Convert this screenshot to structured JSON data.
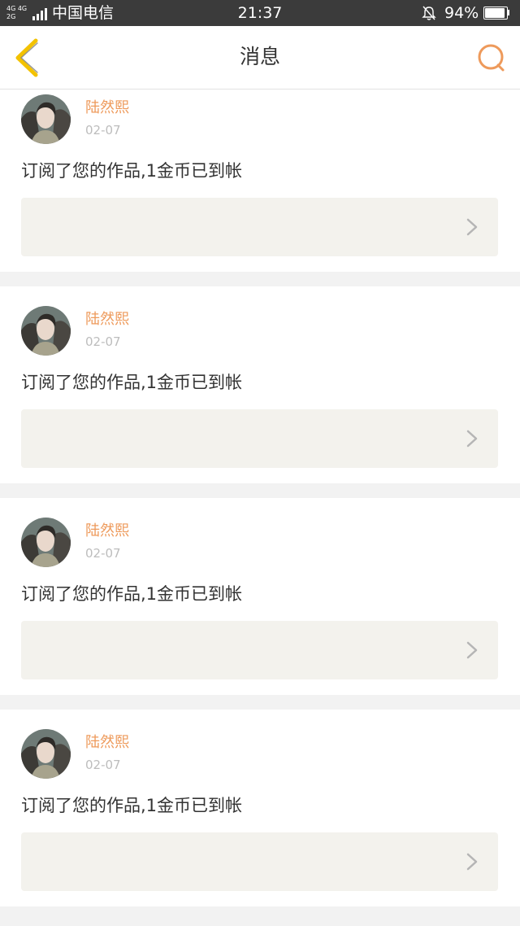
{
  "status_bar": {
    "network_top": "4G 4G",
    "network_bottom": "2G",
    "carrier": "中国电信",
    "time": "21:37",
    "battery_percent": "94%",
    "battery_level": 0.94
  },
  "header": {
    "title": "消息",
    "back_icon": "chevron-left-icon",
    "search_icon": "search-icon"
  },
  "colors": {
    "accent_back": "#f3c200",
    "accent_orange": "#ee9a5b",
    "attachment_bg": "#f3f2ed",
    "separator": "#f2f2f2"
  },
  "messages": [
    {
      "username": "陆然熙",
      "date": "02-07",
      "text": "订阅了您的作品,1金币已到帐"
    },
    {
      "username": "陆然熙",
      "date": "02-07",
      "text": "订阅了您的作品,1金币已到帐"
    },
    {
      "username": "陆然熙",
      "date": "02-07",
      "text": "订阅了您的作品,1金币已到帐"
    },
    {
      "username": "陆然熙",
      "date": "02-07",
      "text": "订阅了您的作品,1金币已到帐"
    }
  ]
}
